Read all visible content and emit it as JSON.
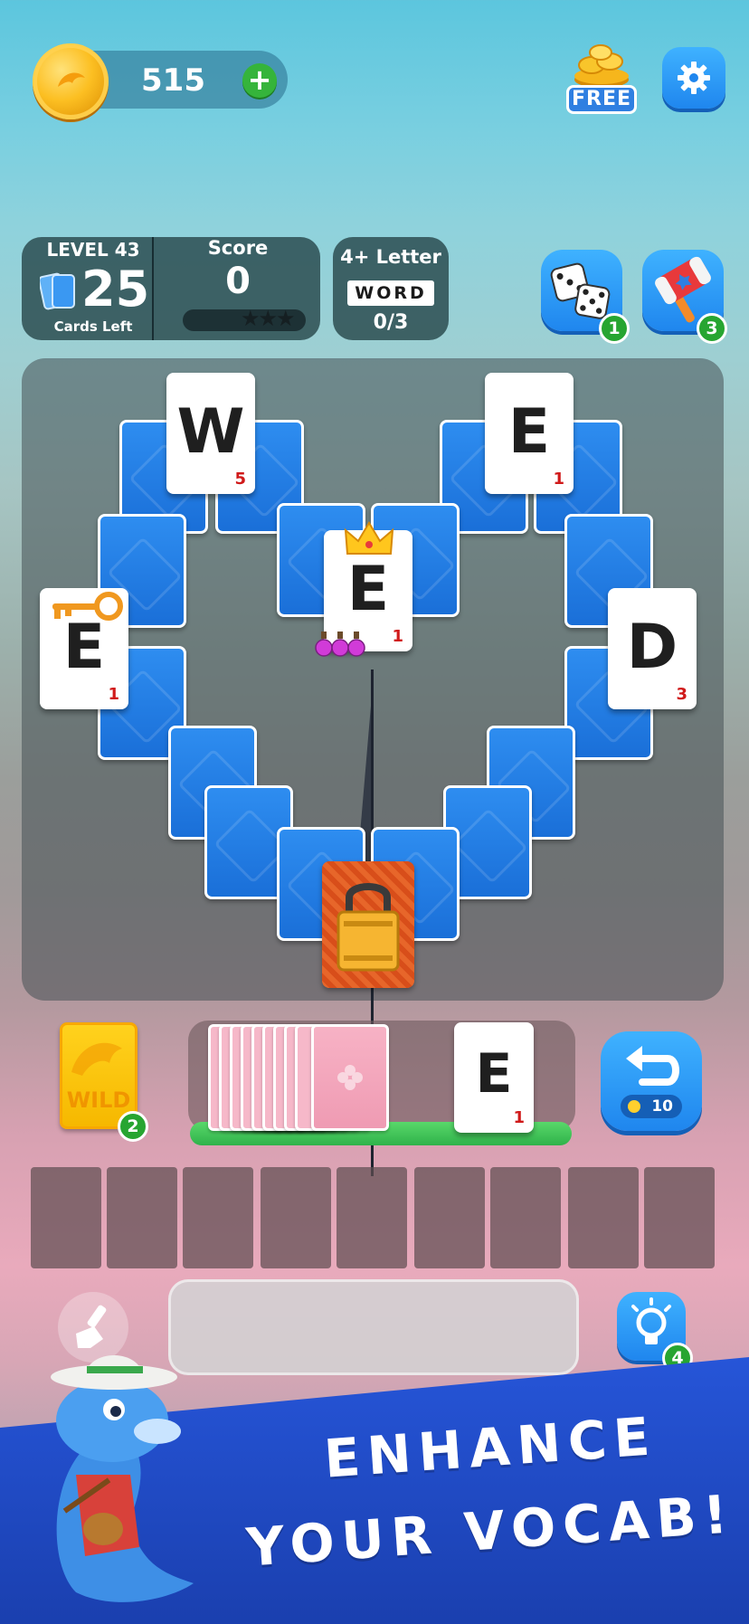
{
  "top_bar": {
    "coin_balance": "515",
    "add_coins_symbol": "+",
    "free_label": "FREE"
  },
  "hud": {
    "level_label": "LEVEL 43",
    "cards_left_count": "25",
    "cards_left_label": "Cards Left",
    "score_label": "Score",
    "score_value": "0",
    "score_stars": "★★★",
    "word_requirement": "4+ Letter",
    "word_box": "WORD",
    "word_progress": "0/3"
  },
  "powerups": {
    "dice_count": "1",
    "hammer_count": "3",
    "wild_count": "2",
    "hint_count": "4",
    "undo_cost": "10"
  },
  "board": {
    "face_cards": [
      {
        "letter": "W",
        "points": "5"
      },
      {
        "letter": "E",
        "points": "1"
      },
      {
        "letter": "E",
        "points": "1"
      },
      {
        "letter": "E",
        "points": "1"
      },
      {
        "letter": "D",
        "points": "3"
      }
    ]
  },
  "deck": {
    "wild_label": "WILD",
    "waste_card": {
      "letter": "E",
      "points": "1"
    }
  },
  "banner": {
    "line1": "ENHANCE",
    "line2": "YOUR  VOCAB!"
  },
  "colors": {
    "accent_blue": "#1f86ee",
    "card_back": "#2e8df0",
    "points_red": "#d01a1a",
    "badge_green": "#27a531",
    "coin_gold": "#fcbf22"
  }
}
